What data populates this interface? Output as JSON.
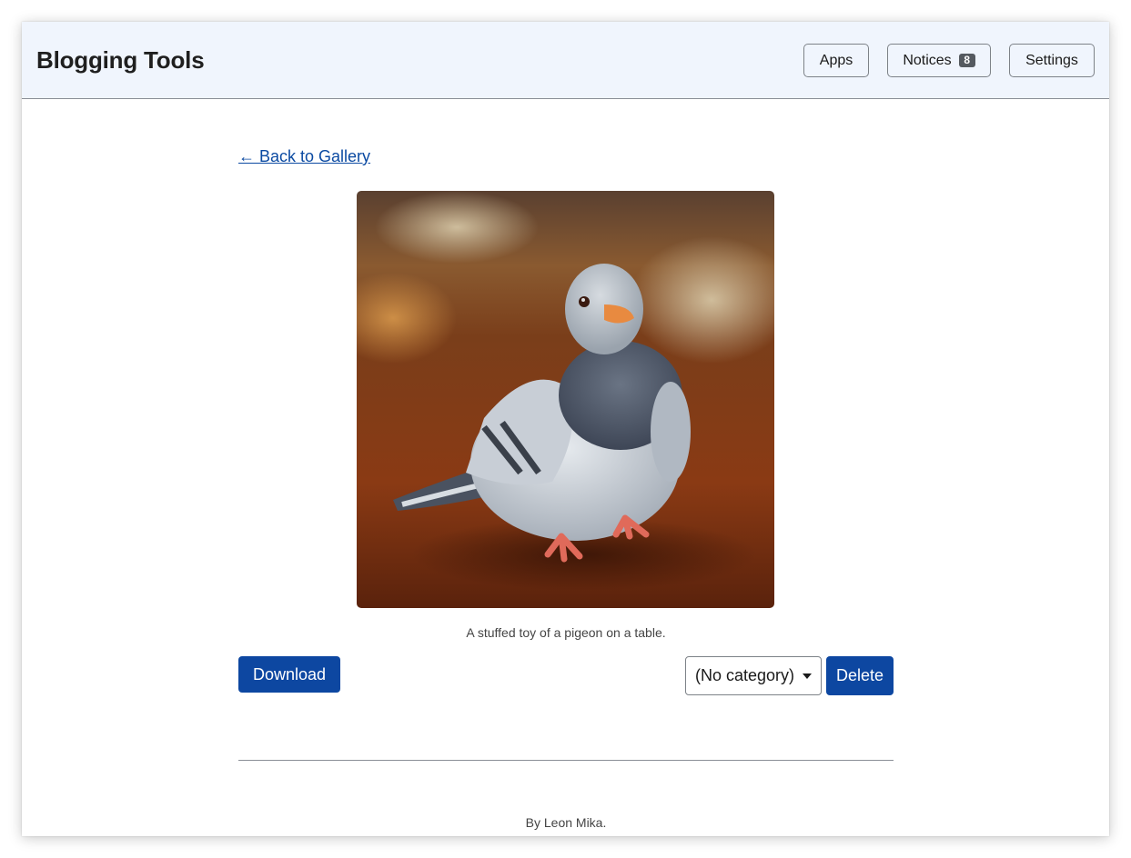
{
  "header": {
    "title": "Blogging Tools",
    "nav": {
      "apps_label": "Apps",
      "notices_label": "Notices",
      "notices_count": "8",
      "settings_label": "Settings"
    }
  },
  "main": {
    "back_link": "← Back to Gallery",
    "image": {
      "caption": "A stuffed toy of a pigeon on a table."
    },
    "download_label": "Download",
    "category_select": {
      "selected": "(No category)"
    },
    "delete_label": "Delete"
  },
  "footer": {
    "text": "By Leon Mika."
  },
  "colors": {
    "header_bg": "#f0f5fd",
    "primary_button": "#0d47a1",
    "link": "#0b4aa2",
    "badge_bg": "#555a60"
  },
  "icons": {
    "select_caret": "chevron-down-icon"
  }
}
